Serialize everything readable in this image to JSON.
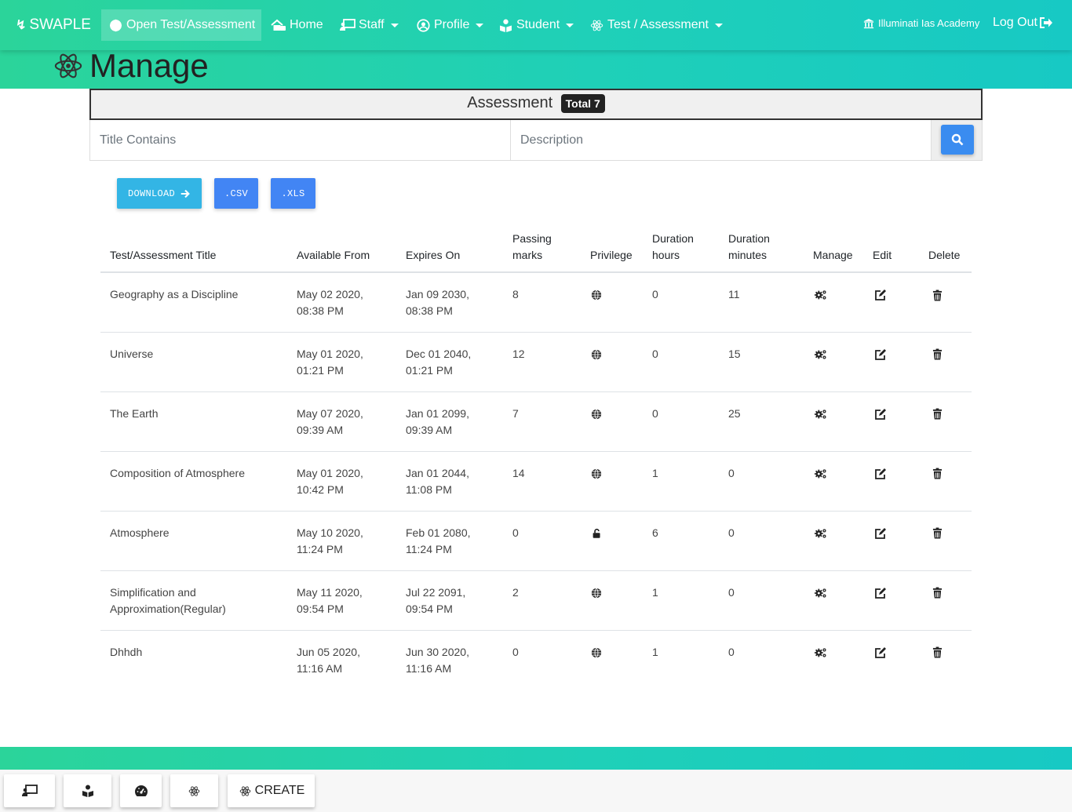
{
  "navbar": {
    "brand": "SWAPLE",
    "items": [
      {
        "label": "Open Test/Assessment",
        "icon": "globe-icon"
      },
      {
        "label": "Home",
        "icon": "home-icon"
      },
      {
        "label": "Staff",
        "icon": "chalkboard-teacher-icon"
      },
      {
        "label": "Profile",
        "icon": "user-circle-icon"
      },
      {
        "label": "Student",
        "icon": "book-reader-icon"
      },
      {
        "label": "Test / Assessment",
        "icon": "atom-icon"
      }
    ],
    "institution": "Illuminati Ias Academy",
    "logout": "Log Out"
  },
  "page": {
    "title": "Manage"
  },
  "assessment": {
    "label": "Assessment",
    "total_badge": "Total 7"
  },
  "search": {
    "title_placeholder": "Title Contains",
    "description_placeholder": "Description"
  },
  "export": {
    "download": "DOWNLOAD",
    "csv": ".CSV",
    "xls": ".XLS"
  },
  "table": {
    "headers": {
      "title": "Test/Assessment Title",
      "available_from": "Available From",
      "expires_on": "Expires On",
      "passing_marks_1": "Passing",
      "passing_marks_2": "marks",
      "privilege": "Privilege",
      "duration_hours_1": "Duration",
      "duration_hours_2": "hours",
      "duration_minutes_1": "Duration",
      "duration_minutes_2": "minutes",
      "manage": "Manage",
      "edit": "Edit",
      "delete": "Delete"
    },
    "rows": [
      {
        "title": "Geography as a Discipline",
        "from_date": "May 02 2020,",
        "from_time": "08:38 PM",
        "exp_date": "Jan 09 2030,",
        "exp_time": "08:38 PM",
        "passing": "8",
        "privilege": "globe-icon",
        "hours": "0",
        "minutes": "11"
      },
      {
        "title": "Universe",
        "from_date": "May 01 2020,",
        "from_time": "01:21 PM",
        "exp_date": "Dec 01 2040,",
        "exp_time": "01:21 PM",
        "passing": "12",
        "privilege": "globe-icon",
        "hours": "0",
        "minutes": "15"
      },
      {
        "title": "The Earth",
        "from_date": "May 07 2020,",
        "from_time": "09:39 AM",
        "exp_date": "Jan 01 2099,",
        "exp_time": "09:39 AM",
        "passing": "7",
        "privilege": "globe-icon",
        "hours": "0",
        "minutes": "25"
      },
      {
        "title": "Composition of Atmosphere",
        "from_date": "May 01 2020,",
        "from_time": "10:42 PM",
        "exp_date": "Jan 01 2044,",
        "exp_time": "11:08 PM",
        "passing": "14",
        "privilege": "globe-icon",
        "hours": "1",
        "minutes": "0"
      },
      {
        "title": "Atmosphere",
        "from_date": "May 10 2020,",
        "from_time": "11:24 PM",
        "exp_date": "Feb 01 2080,",
        "exp_time": "11:24 PM",
        "passing": "0",
        "privilege": "unlock-icon",
        "hours": "6",
        "minutes": "0"
      },
      {
        "title_1": "Simplification and",
        "title_2": "Approximation(Regular)",
        "from_date": "May 11 2020,",
        "from_time": "09:54 PM",
        "exp_date": "Jul 22 2091,",
        "exp_time": "09:54 PM",
        "passing": "2",
        "privilege": "globe-icon",
        "hours": "1",
        "minutes": "0"
      },
      {
        "title": "Dhhdh",
        "from_date": "Jun 05 2020,",
        "from_time": "11:16 AM",
        "exp_date": "Jun 30 2020,",
        "exp_time": "11:16 AM",
        "passing": "0",
        "privilege": "globe-icon",
        "hours": "1",
        "minutes": "0"
      }
    ]
  },
  "footer": {
    "create_label": "CREATE"
  },
  "colors": {
    "brand_green": "#2bd49a",
    "brand_teal": "#17c9c4",
    "primary": "#4285f4",
    "info": "#33b5e5",
    "logo_red": "#e8334f"
  }
}
